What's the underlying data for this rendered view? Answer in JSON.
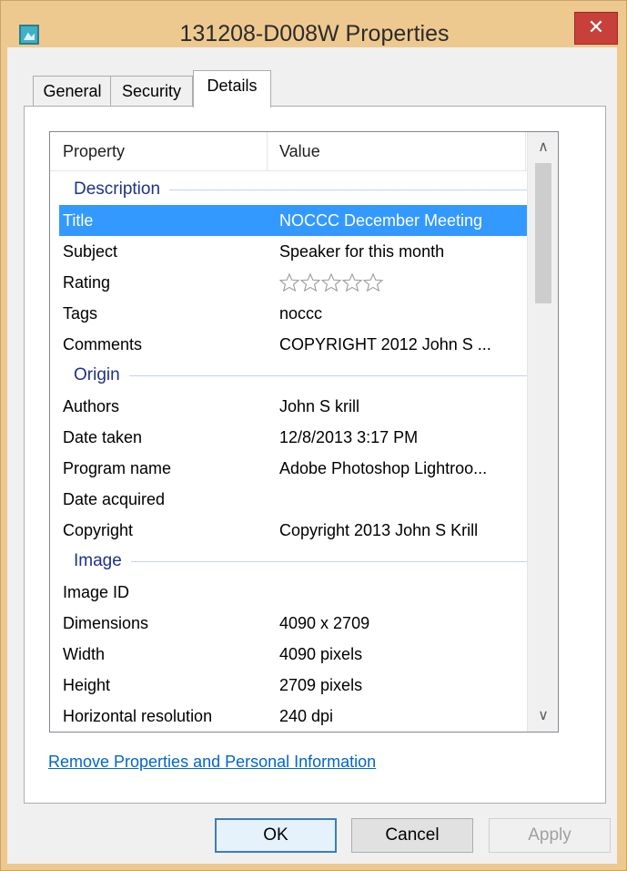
{
  "window": {
    "title": "131208-D008W Properties",
    "close_glyph": "✕",
    "icon": "image-file-icon",
    "colors": {
      "frame": "#eec98f",
      "close": "#c7403a",
      "selection": "#3399ff",
      "group_text": "#1e3287",
      "link": "#0066cc"
    }
  },
  "tabs": [
    {
      "label": "General",
      "active": false
    },
    {
      "label": "Security",
      "active": false
    },
    {
      "label": "Details",
      "active": true
    }
  ],
  "list": {
    "columns": [
      "Property",
      "Value"
    ],
    "groups": [
      {
        "title": "Description",
        "rows": [
          {
            "name": "Title",
            "value": "NOCCC December Meeting",
            "selected": true
          },
          {
            "name": "Subject",
            "value": "Speaker for this month"
          },
          {
            "name": "Rating",
            "value": "",
            "stars": 0,
            "stars_max": 5
          },
          {
            "name": "Tags",
            "value": "noccc"
          },
          {
            "name": "Comments",
            "value": "COPYRIGHT 2012 John S ..."
          }
        ]
      },
      {
        "title": "Origin",
        "rows": [
          {
            "name": "Authors",
            "value": "John S krill"
          },
          {
            "name": "Date taken",
            "value": "12/8/2013 3:17 PM"
          },
          {
            "name": "Program name",
            "value": "Adobe Photoshop Lightroo..."
          },
          {
            "name": "Date acquired",
            "value": ""
          },
          {
            "name": "Copyright",
            "value": "Copyright 2013 John S Krill"
          }
        ]
      },
      {
        "title": "Image",
        "rows": [
          {
            "name": "Image ID",
            "value": ""
          },
          {
            "name": "Dimensions",
            "value": "4090 x 2709"
          },
          {
            "name": "Width",
            "value": "4090 pixels"
          },
          {
            "name": "Height",
            "value": "2709 pixels"
          },
          {
            "name": "Horizontal resolution",
            "value": "240 dpi"
          }
        ]
      }
    ],
    "scroll_up_glyph": "∧",
    "scroll_down_glyph": "∨"
  },
  "link": "Remove Properties and Personal Information",
  "buttons": {
    "ok": "OK",
    "cancel": "Cancel",
    "apply": "Apply"
  }
}
